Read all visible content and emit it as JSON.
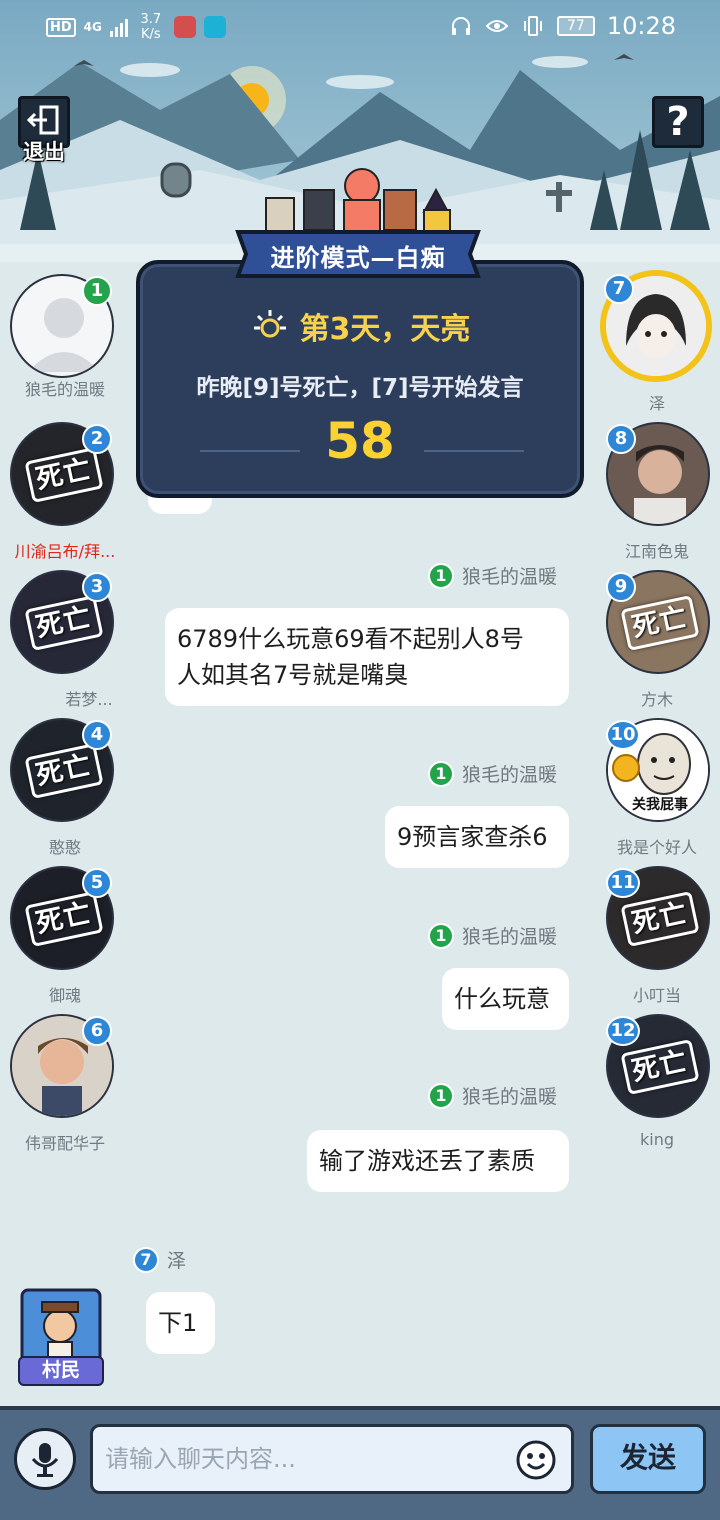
{
  "status_bar": {
    "hd": "HD",
    "network": "4G",
    "speed": "3.7 K/s",
    "battery": "77",
    "time": "10:28"
  },
  "header": {
    "exit_label": "退出",
    "help_label": "?"
  },
  "panel": {
    "mode_title": "进阶模式—白痴",
    "day_title": "第3天，天亮",
    "death_info": "昨晚[9]号死亡，[7]号开始发言",
    "countdown": "58"
  },
  "players_left": [
    {
      "num": "1",
      "name": "狼毛的温暖",
      "dead": false
    },
    {
      "num": "2",
      "name": "川渝吕布/拜...",
      "dead": true
    },
    {
      "num": "3",
      "name": "若梦...",
      "dead": true
    },
    {
      "num": "4",
      "name": "憨憨",
      "dead": true
    },
    {
      "num": "5",
      "name": "御魂",
      "dead": true
    },
    {
      "num": "6",
      "name": "伟哥配华子",
      "dead": false
    }
  ],
  "players_right": [
    {
      "num": "7",
      "name": "泽",
      "dead": false
    },
    {
      "num": "8",
      "name": "江南色鬼",
      "dead": false
    },
    {
      "num": "9",
      "name": "方木",
      "dead": true
    },
    {
      "num": "10",
      "name": "我是个好人",
      "dead": false
    },
    {
      "num": "11",
      "name": "小叮当",
      "dead": true
    },
    {
      "num": "12",
      "name": "king",
      "dead": true
    }
  ],
  "dead_stamp": "死亡",
  "avatar10_caption": "关我屁事",
  "messages": [
    {
      "num": "1",
      "sender": "狼毛的温暖",
      "text_line1": "6789什么玩意69看不起别人8号",
      "text_line2": "人如其名7号就是嘴臭"
    },
    {
      "num": "1",
      "sender": "狼毛的温暖",
      "text": "9预言家查杀6"
    },
    {
      "num": "1",
      "sender": "狼毛的温暖",
      "text": "什么玩意"
    },
    {
      "num": "1",
      "sender": "狼毛的温暖",
      "text": "输了游戏还丢了素质"
    },
    {
      "num": "7",
      "sender": "泽",
      "text": "下1"
    }
  ],
  "role": {
    "label": "村民"
  },
  "input": {
    "placeholder": "请输入聊天内容..."
  },
  "send_label": "发送",
  "colors": {
    "accent": "#2d86d6",
    "self_badge": "#24a44a",
    "panel": "#2d3e5c",
    "countdown": "#fbd232"
  }
}
